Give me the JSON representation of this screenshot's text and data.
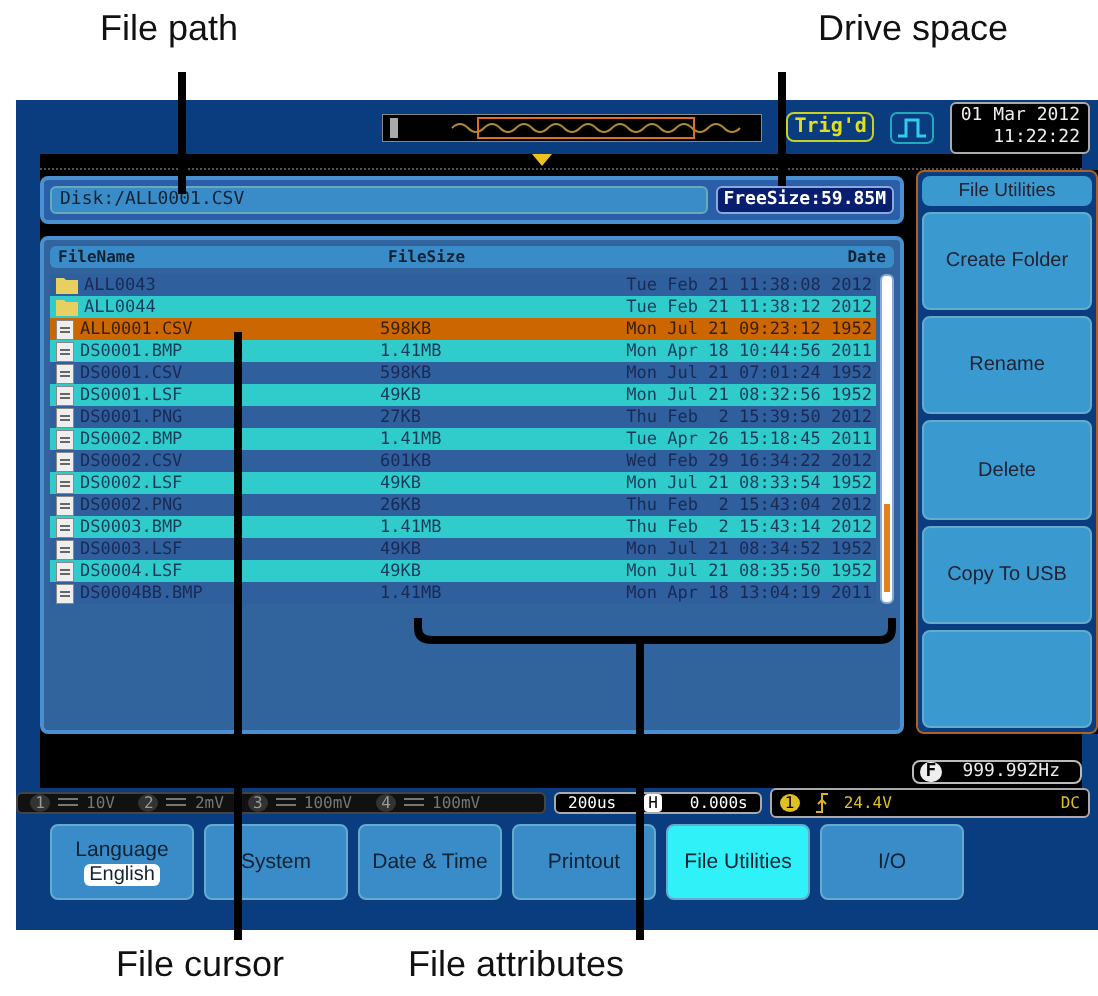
{
  "callouts": {
    "file_path": "File path",
    "drive_space": "Drive space",
    "file_cursor": "File cursor",
    "file_attributes": "File attributes"
  },
  "status_bar": {
    "trigger_state": "Trig'd",
    "date": "01 Mar 2012",
    "time": "11:22:22"
  },
  "file_path": "Disk:/ALL0001.CSV",
  "free_size": "FreeSize:59.85M",
  "table": {
    "columns": [
      "FileName",
      "FileSize",
      "Date"
    ],
    "rows": [
      {
        "kind": "folder",
        "name": "ALL0043",
        "date": "Tue Feb 21 11:38:08 2012",
        "selected": false
      },
      {
        "kind": "folder",
        "name": "ALL0044",
        "date": "Tue Feb 21 11:38:12 2012",
        "selected": false
      },
      {
        "kind": "file",
        "name": "ALL0001.CSV",
        "size": "598KB",
        "date": "Mon Jul 21 09:23:12 1952",
        "selected": true
      },
      {
        "kind": "file",
        "name": "DS0001.BMP",
        "size": "1.41MB",
        "date": "Mon Apr 18 10:44:56 2011",
        "selected": false
      },
      {
        "kind": "file",
        "name": "DS0001.CSV",
        "size": "598KB",
        "date": "Mon Jul 21 07:01:24 1952",
        "selected": false
      },
      {
        "kind": "file",
        "name": "DS0001.LSF",
        "size": "49KB",
        "date": "Mon Jul 21 08:32:56 1952",
        "selected": false
      },
      {
        "kind": "file",
        "name": "DS0001.PNG",
        "size": "27KB",
        "date": "Thu Feb  2 15:39:50 2012",
        "selected": false
      },
      {
        "kind": "file",
        "name": "DS0002.BMP",
        "size": "1.41MB",
        "date": "Tue Apr 26 15:18:45 2011",
        "selected": false
      },
      {
        "kind": "file",
        "name": "DS0002.CSV",
        "size": "601KB",
        "date": "Wed Feb 29 16:34:22 2012",
        "selected": false
      },
      {
        "kind": "file",
        "name": "DS0002.LSF",
        "size": "49KB",
        "date": "Mon Jul 21 08:33:54 1952",
        "selected": false
      },
      {
        "kind": "file",
        "name": "DS0002.PNG",
        "size": "26KB",
        "date": "Thu Feb  2 15:43:04 2012",
        "selected": false
      },
      {
        "kind": "file",
        "name": "DS0003.BMP",
        "size": "1.41MB",
        "date": "Thu Feb  2 15:43:14 2012",
        "selected": false
      },
      {
        "kind": "file",
        "name": "DS0003.LSF",
        "size": "49KB",
        "date": "Mon Jul 21 08:34:52 1952",
        "selected": false
      },
      {
        "kind": "file",
        "name": "DS0004.LSF",
        "size": "49KB",
        "date": "Mon Jul 21 08:35:50 1952",
        "selected": false
      },
      {
        "kind": "file",
        "name": "DS0004BB.BMP",
        "size": "1.41MB",
        "date": "Mon Apr 18 13:04:19 2011",
        "selected": false
      }
    ]
  },
  "side_menu": {
    "title": "File Utilities",
    "items": [
      "Create Folder",
      "Rename",
      "Delete",
      "Copy To USB"
    ]
  },
  "frequency": {
    "label": "F",
    "value": "999.992Hz"
  },
  "channels": [
    {
      "number": "1",
      "scale": "10V"
    },
    {
      "number": "2",
      "scale": "2mV"
    },
    {
      "number": "3",
      "scale": "100mV"
    },
    {
      "number": "4",
      "scale": "100mV"
    }
  ],
  "timebase": {
    "scale": "200us",
    "position_label": "H",
    "position": "0.000s"
  },
  "trigger": {
    "channel": "1",
    "level": "24.4V",
    "coupling": "DC"
  },
  "softkeys": [
    {
      "label": "Language",
      "value": "English",
      "selected": false
    },
    {
      "label": "System",
      "selected": false
    },
    {
      "label": "Date & Time",
      "selected": false
    },
    {
      "label": "Printout",
      "selected": false
    },
    {
      "label": "File Utilities",
      "selected": true
    },
    {
      "label": "I/O",
      "selected": false
    }
  ]
}
